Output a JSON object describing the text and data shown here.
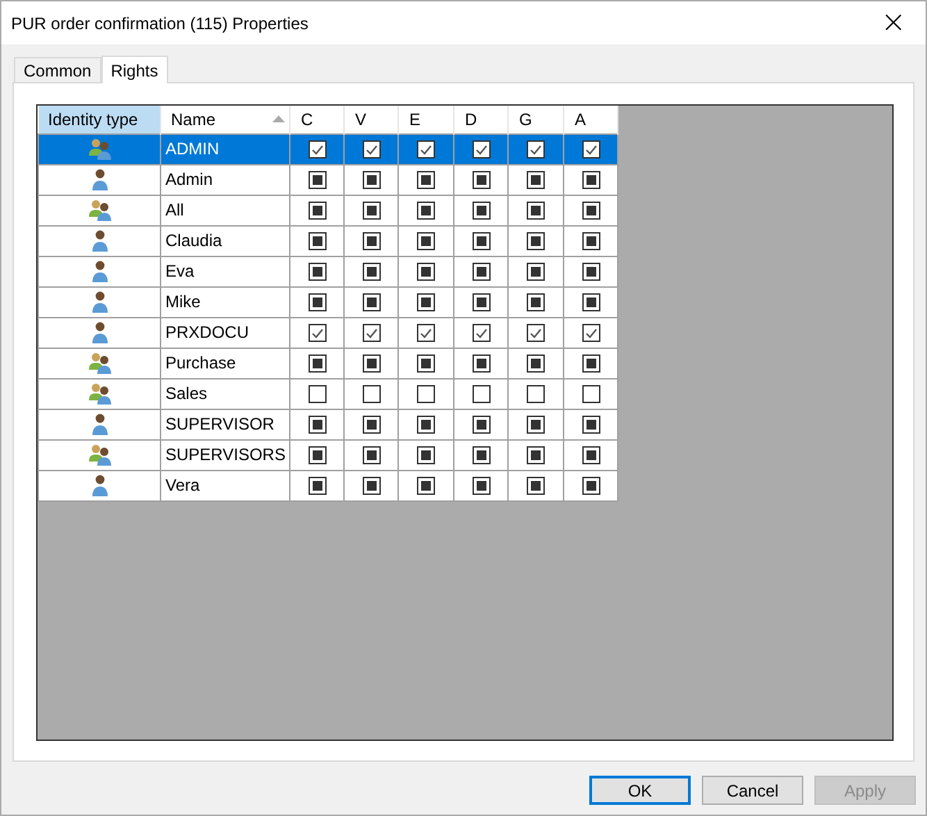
{
  "window": {
    "title": "PUR order confirmation (115) Properties",
    "close": "×"
  },
  "tabs": [
    {
      "label": "Common",
      "selected": false
    },
    {
      "label": "Rights",
      "selected": true
    }
  ],
  "grid": {
    "columns": [
      {
        "label": "Identity type",
        "highlighted": true,
        "sorted": false
      },
      {
        "label": "Name",
        "highlighted": false,
        "sorted": true
      },
      {
        "label": "C",
        "highlighted": false,
        "sorted": false
      },
      {
        "label": "V",
        "highlighted": false,
        "sorted": false
      },
      {
        "label": "E",
        "highlighted": false,
        "sorted": false
      },
      {
        "label": "D",
        "highlighted": false,
        "sorted": false
      },
      {
        "label": "G",
        "highlighted": false,
        "sorted": false
      },
      {
        "label": "A",
        "highlighted": false,
        "sorted": false
      }
    ],
    "rows": [
      {
        "kind": "group",
        "name": "ADMIN",
        "selected": true,
        "rights": [
          {
            "checked": true,
            "indeterminate": false
          },
          {
            "checked": true,
            "indeterminate": false
          },
          {
            "checked": true,
            "indeterminate": false
          },
          {
            "checked": true,
            "indeterminate": false
          },
          {
            "checked": true,
            "indeterminate": false
          },
          {
            "checked": true,
            "indeterminate": false
          }
        ]
      },
      {
        "kind": "user",
        "name": "Admin",
        "selected": false,
        "rights": [
          {
            "checked": false,
            "indeterminate": true
          },
          {
            "checked": false,
            "indeterminate": true
          },
          {
            "checked": false,
            "indeterminate": true
          },
          {
            "checked": false,
            "indeterminate": true
          },
          {
            "checked": false,
            "indeterminate": true
          },
          {
            "checked": false,
            "indeterminate": true
          }
        ]
      },
      {
        "kind": "group",
        "name": "All",
        "selected": false,
        "rights": [
          {
            "checked": false,
            "indeterminate": true
          },
          {
            "checked": false,
            "indeterminate": true
          },
          {
            "checked": false,
            "indeterminate": true
          },
          {
            "checked": false,
            "indeterminate": true
          },
          {
            "checked": false,
            "indeterminate": true
          },
          {
            "checked": false,
            "indeterminate": true
          }
        ]
      },
      {
        "kind": "user",
        "name": "Claudia",
        "selected": false,
        "rights": [
          {
            "checked": false,
            "indeterminate": true
          },
          {
            "checked": false,
            "indeterminate": true
          },
          {
            "checked": false,
            "indeterminate": true
          },
          {
            "checked": false,
            "indeterminate": true
          },
          {
            "checked": false,
            "indeterminate": true
          },
          {
            "checked": false,
            "indeterminate": true
          }
        ]
      },
      {
        "kind": "user",
        "name": "Eva",
        "selected": false,
        "rights": [
          {
            "checked": false,
            "indeterminate": true
          },
          {
            "checked": false,
            "indeterminate": true
          },
          {
            "checked": false,
            "indeterminate": true
          },
          {
            "checked": false,
            "indeterminate": true
          },
          {
            "checked": false,
            "indeterminate": true
          },
          {
            "checked": false,
            "indeterminate": true
          }
        ]
      },
      {
        "kind": "user",
        "name": "Mike",
        "selected": false,
        "rights": [
          {
            "checked": false,
            "indeterminate": true
          },
          {
            "checked": false,
            "indeterminate": true
          },
          {
            "checked": false,
            "indeterminate": true
          },
          {
            "checked": false,
            "indeterminate": true
          },
          {
            "checked": false,
            "indeterminate": true
          },
          {
            "checked": false,
            "indeterminate": true
          }
        ]
      },
      {
        "kind": "user",
        "name": "PRXDOCU",
        "selected": false,
        "rights": [
          {
            "checked": true,
            "indeterminate": false
          },
          {
            "checked": true,
            "indeterminate": false
          },
          {
            "checked": true,
            "indeterminate": false
          },
          {
            "checked": true,
            "indeterminate": false
          },
          {
            "checked": true,
            "indeterminate": false
          },
          {
            "checked": true,
            "indeterminate": false
          }
        ]
      },
      {
        "kind": "group",
        "name": "Purchase",
        "selected": false,
        "rights": [
          {
            "checked": false,
            "indeterminate": true
          },
          {
            "checked": false,
            "indeterminate": true
          },
          {
            "checked": false,
            "indeterminate": true
          },
          {
            "checked": false,
            "indeterminate": true
          },
          {
            "checked": false,
            "indeterminate": true
          },
          {
            "checked": false,
            "indeterminate": true
          }
        ]
      },
      {
        "kind": "group",
        "name": "Sales",
        "selected": false,
        "rights": [
          {
            "checked": false,
            "indeterminate": false
          },
          {
            "checked": false,
            "indeterminate": false
          },
          {
            "checked": false,
            "indeterminate": false
          },
          {
            "checked": false,
            "indeterminate": false
          },
          {
            "checked": false,
            "indeterminate": false
          },
          {
            "checked": false,
            "indeterminate": false
          }
        ]
      },
      {
        "kind": "user",
        "name": "SUPERVISOR",
        "selected": false,
        "rights": [
          {
            "checked": false,
            "indeterminate": true
          },
          {
            "checked": false,
            "indeterminate": true
          },
          {
            "checked": false,
            "indeterminate": true
          },
          {
            "checked": false,
            "indeterminate": true
          },
          {
            "checked": false,
            "indeterminate": true
          },
          {
            "checked": false,
            "indeterminate": true
          }
        ]
      },
      {
        "kind": "group",
        "name": "SUPERVISORS",
        "selected": false,
        "rights": [
          {
            "checked": false,
            "indeterminate": true
          },
          {
            "checked": false,
            "indeterminate": true
          },
          {
            "checked": false,
            "indeterminate": true
          },
          {
            "checked": false,
            "indeterminate": true
          },
          {
            "checked": false,
            "indeterminate": true
          },
          {
            "checked": false,
            "indeterminate": true
          }
        ]
      },
      {
        "kind": "user",
        "name": "Vera",
        "selected": false,
        "rights": [
          {
            "checked": false,
            "indeterminate": true
          },
          {
            "checked": false,
            "indeterminate": true
          },
          {
            "checked": false,
            "indeterminate": true
          },
          {
            "checked": false,
            "indeterminate": true
          },
          {
            "checked": false,
            "indeterminate": true
          },
          {
            "checked": false,
            "indeterminate": true
          }
        ]
      }
    ]
  },
  "buttons": [
    {
      "label": "OK",
      "default": true,
      "disabled": false
    },
    {
      "label": "Cancel",
      "default": false,
      "disabled": false
    },
    {
      "label": "Apply",
      "default": false,
      "disabled": true
    }
  ]
}
